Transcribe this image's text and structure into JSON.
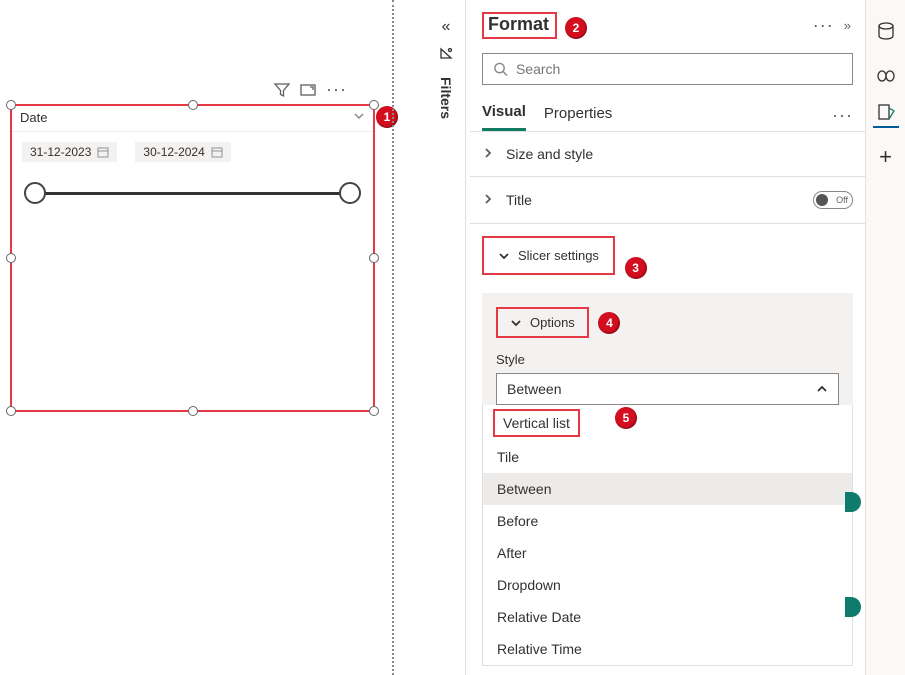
{
  "canvas": {
    "toolbar": {
      "icons": [
        "funnel-icon",
        "focus-mode-icon",
        "more-icon"
      ]
    }
  },
  "slicer": {
    "title": "Date",
    "date_start": "31-12-2023",
    "date_end": "30-12-2024"
  },
  "filters_pane": {
    "label": "Filters"
  },
  "pane": {
    "title": "Format",
    "search_placeholder": "Search",
    "tabs": {
      "visual": "Visual",
      "properties": "Properties"
    },
    "sections": {
      "size_style": "Size and style",
      "title": "Title",
      "title_toggle": "Off",
      "slicer_settings": "Slicer settings"
    },
    "options": {
      "label": "Options",
      "style_label": "Style",
      "style_value": "Between",
      "menu": [
        "Vertical list",
        "Tile",
        "Between",
        "Before",
        "After",
        "Dropdown",
        "Relative Date",
        "Relative Time"
      ]
    }
  },
  "annotations": {
    "a1": "1",
    "a2": "2",
    "a3": "3",
    "a4": "4",
    "a5": "5"
  }
}
